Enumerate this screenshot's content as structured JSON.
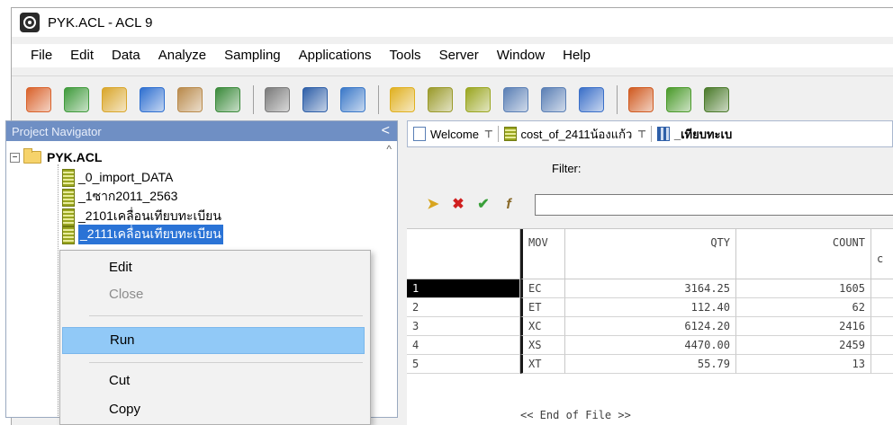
{
  "window": {
    "title": "PYK.ACL - ACL 9"
  },
  "menu": [
    "File",
    "Edit",
    "Data",
    "Analyze",
    "Sampling",
    "Applications",
    "Tools",
    "Server",
    "Window",
    "Help"
  ],
  "toolbar": {
    "icons": [
      {
        "name": "new-project-icon",
        "color": "#d9622b"
      },
      {
        "name": "open-project-icon",
        "color": "#3f9a3b"
      },
      {
        "name": "open-table-icon",
        "color": "#d9a62b"
      },
      {
        "name": "save-icon",
        "color": "#2e6fd0"
      },
      {
        "name": "print-icon",
        "color": "#b98a4b"
      },
      {
        "name": "find-icon",
        "color": "#3a8a3a"
      },
      {
        "name": "refresh-icon",
        "color": "#7a7a7a"
      },
      {
        "name": "table-layout-icon",
        "color": "#2e5fa8"
      },
      {
        "name": "filter-icon",
        "color": "#3a78c8"
      },
      {
        "name": "copy-icon",
        "color": "#e0b020"
      },
      {
        "name": "edit-icon",
        "color": "#9a9a2a"
      },
      {
        "name": "add-column-icon",
        "color": "#9aa620"
      },
      {
        "name": "modify-column-icon",
        "color": "#5a7fb5"
      },
      {
        "name": "remove-column-icon",
        "color": "#5a7fb5"
      },
      {
        "name": "font-icon",
        "color": "#3a6fc8"
      },
      {
        "name": "chart-icon",
        "color": "#d05a20"
      },
      {
        "name": "statistics-icon",
        "color": "#4a9a2a"
      },
      {
        "name": "sigma-icon",
        "color": "#4a7a2a"
      }
    ]
  },
  "navigator": {
    "header": "Project Navigator",
    "collapse_glyph": "<",
    "root": "PYK.ACL",
    "items": [
      "_0_import_DATA",
      "_1ซาก2011_2563",
      "_2101เคลื่อนเทียบทะเบียน",
      "_2111เคลื่อนเทียบทะเบียน"
    ]
  },
  "context_menu": {
    "items": [
      {
        "label": "Edit",
        "enabled": true
      },
      {
        "label": "Close",
        "enabled": false
      },
      {
        "label": "Run",
        "enabled": true,
        "highlighted": true
      },
      {
        "label": "Cut",
        "enabled": true
      },
      {
        "label": "Copy",
        "enabled": true
      }
    ]
  },
  "tabs": [
    {
      "label": "Welcome",
      "icon": "document-icon"
    },
    {
      "label": "cost_of_2411น้องแก้ว",
      "icon": "table-icon"
    },
    {
      "label": "_เทียบทะเบ",
      "icon": "grid-icon"
    }
  ],
  "filter": {
    "label": "Filter:",
    "value": ""
  },
  "table": {
    "columns": [
      "MOV",
      "QTY",
      "COUNT"
    ],
    "count_subtext": "c",
    "rows": [
      {
        "n": "1",
        "mov": "EC",
        "qty": "3164.25",
        "count": "1605"
      },
      {
        "n": "2",
        "mov": "ET",
        "qty": "112.40",
        "count": "62"
      },
      {
        "n": "3",
        "mov": "XC",
        "qty": "6124.20",
        "count": "2416"
      },
      {
        "n": "4",
        "mov": "XS",
        "qty": "4470.00",
        "count": "2459"
      },
      {
        "n": "5",
        "mov": "XT",
        "qty": "55.79",
        "count": "13"
      }
    ],
    "eof": "<< End of File >>"
  }
}
